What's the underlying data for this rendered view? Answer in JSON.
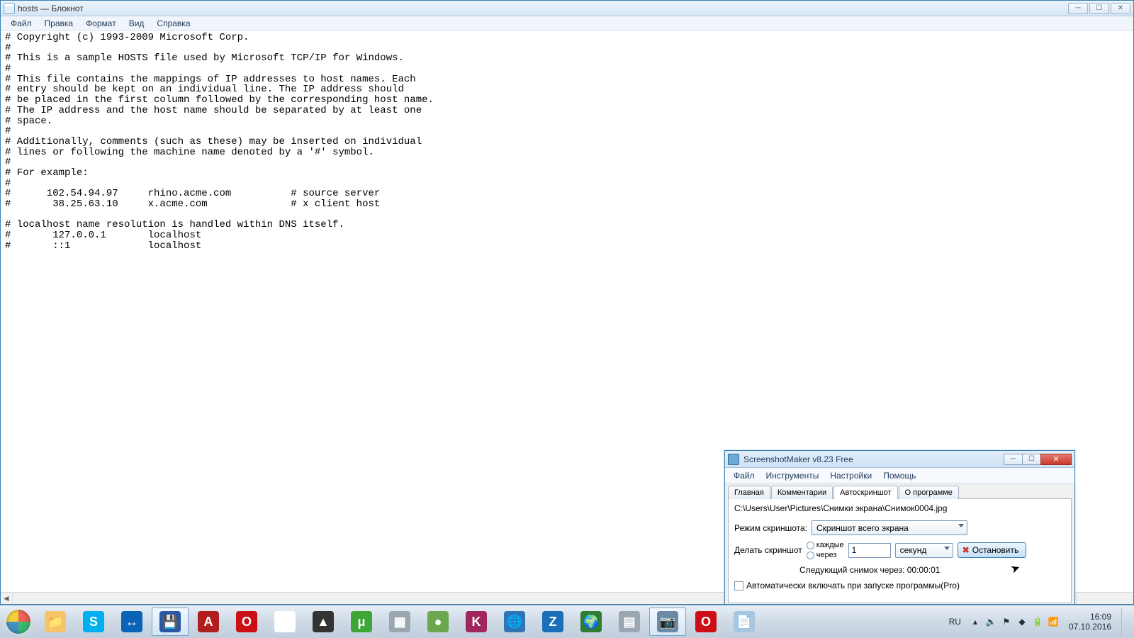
{
  "notepad": {
    "title": "hosts — Блокнот",
    "menu": [
      "Файл",
      "Правка",
      "Формат",
      "Вид",
      "Справка"
    ],
    "win_buttons": {
      "min": "─",
      "max": "☐",
      "close": "✕"
    },
    "content": "# Copyright (c) 1993-2009 Microsoft Corp.\n#\n# This is a sample HOSTS file used by Microsoft TCP/IP for Windows.\n#\n# This file contains the mappings of IP addresses to host names. Each\n# entry should be kept on an individual line. The IP address should\n# be placed in the first column followed by the corresponding host name.\n# The IP address and the host name should be separated by at least one\n# space.\n#\n# Additionally, comments (such as these) may be inserted on individual\n# lines or following the machine name denoted by a '#' symbol.\n#\n# For example:\n#\n#      102.54.94.97     rhino.acme.com          # source server\n#       38.25.63.10     x.acme.com              # x client host\n\n# localhost name resolution is handled within DNS itself.\n#\t127.0.0.1       localhost\n#\t::1             localhost"
  },
  "ssmaker": {
    "title": "ScreenshotMaker v8.23 Free",
    "menu": [
      "Файл",
      "Инструменты",
      "Настройки",
      "Помощь"
    ],
    "tabs": [
      "Главная",
      "Комментарии",
      "Автоскриншот",
      "О программе"
    ],
    "active_tab": 2,
    "path": "C:\\Users\\User\\Pictures\\Снимки экрана\\Снимок0004.jpg",
    "mode_label": "Режим скриншота:",
    "mode_value": "Скриншот всего экрана",
    "make_label": "Делать скриншот",
    "radio_every": "каждые",
    "radio_after": "через",
    "interval_value": "1",
    "unit_value": "секунд",
    "stop_label": "Остановить",
    "next_label": "Следующий снимок через: 00:00:01",
    "autostart": "Автоматически включать при запуске программы(Pro)"
  },
  "taskbar": {
    "items": [
      {
        "name": "explorer-icon",
        "bg": "#f6c469",
        "glyph": "📁"
      },
      {
        "name": "skype-icon",
        "bg": "#00aff0",
        "glyph": "S"
      },
      {
        "name": "teamviewer-icon",
        "bg": "#0b63b6",
        "glyph": "↔"
      },
      {
        "name": "save-icon",
        "bg": "#2b57a5",
        "glyph": "💾",
        "active": true
      },
      {
        "name": "adobe-reader-icon",
        "bg": "#b11e1e",
        "glyph": "A"
      },
      {
        "name": "opera-old-icon",
        "bg": "#cc0f16",
        "glyph": "O"
      },
      {
        "name": "chrome-icon",
        "bg": "#ffffff",
        "glyph": "◉"
      },
      {
        "name": "aimp-icon",
        "bg": "#333333",
        "glyph": "▲"
      },
      {
        "name": "utorrent-icon",
        "bg": "#3fa535",
        "glyph": "μ"
      },
      {
        "name": "calc-icon",
        "bg": "#9aa7b3",
        "glyph": "▦"
      },
      {
        "name": "circle-icon",
        "bg": "#6aa84f",
        "glyph": "●"
      },
      {
        "name": "k-app-icon",
        "bg": "#a1265e",
        "glyph": "K"
      },
      {
        "name": "globe-blue-icon",
        "bg": "#2f74b5",
        "glyph": "🌐"
      },
      {
        "name": "z-app-icon",
        "bg": "#1b6fb8",
        "glyph": "Z"
      },
      {
        "name": "globe-green-icon",
        "bg": "#2e7d32",
        "glyph": "🌍"
      },
      {
        "name": "taskmgr-icon",
        "bg": "#9aa7b3",
        "glyph": "▤"
      },
      {
        "name": "camera-icon",
        "bg": "#6c8aa6",
        "glyph": "📷",
        "active": true
      },
      {
        "name": "opera-icon",
        "bg": "#cc0f16",
        "glyph": "O"
      },
      {
        "name": "note-icon",
        "bg": "#a8c6e0",
        "glyph": "📄"
      }
    ],
    "lang": "RU",
    "clock_time": "16:09",
    "clock_date": "07.10.2016"
  }
}
